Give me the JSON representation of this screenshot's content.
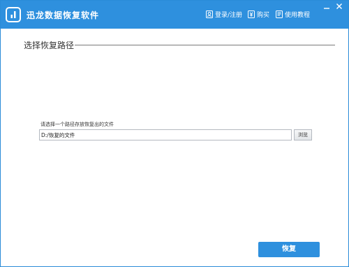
{
  "titlebar": {
    "app_title": "迅龙数据恢复软件",
    "nav": [
      {
        "label": "登录/注册",
        "icon": "login-icon"
      },
      {
        "label": "购买",
        "icon": "yen-icon"
      },
      {
        "label": "使用教程",
        "icon": "book-icon"
      }
    ]
  },
  "section": {
    "title": "选择恢复路径"
  },
  "path": {
    "label": "请选择一个路径存放恢复出的文件",
    "value": "D:/恢复的文件",
    "browse_label": "浏览"
  },
  "footer": {
    "next_label": "恢复"
  },
  "colors": {
    "accent": "#2e90de",
    "border": "#b4b9c0"
  }
}
